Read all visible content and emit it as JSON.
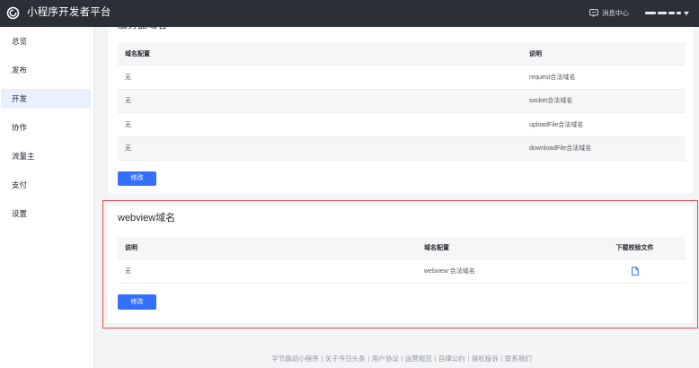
{
  "app": {
    "title": "小程序开发者平台"
  },
  "header": {
    "messages_label": "消息中心"
  },
  "icons": {
    "brand": "logo-icon",
    "messages": "message-icon",
    "user_menu": "chevron-down-icon",
    "download_verification_file": "file-icon"
  },
  "sidebar": {
    "items": [
      {
        "label": "总览"
      },
      {
        "label": "发布"
      },
      {
        "label": "开发",
        "active": true
      },
      {
        "label": "协作"
      },
      {
        "label": "流量主"
      },
      {
        "label": "支付"
      },
      {
        "label": "设置"
      }
    ]
  },
  "server_domain": {
    "title": "服务器域名",
    "columns": {
      "config": "域名配置",
      "description": "说明"
    },
    "rows": [
      {
        "config": "无",
        "description": "request合法域名"
      },
      {
        "config": "无",
        "description": "socket合法域名"
      },
      {
        "config": "无",
        "description": "uploadFile合法域名"
      },
      {
        "config": "无",
        "description": "downloadFile合法域名"
      }
    ],
    "edit_label": "修改"
  },
  "webview_domain": {
    "title": "webview域名",
    "columns": {
      "description": "说明",
      "config": "域名配置",
      "download": "下载校验文件"
    },
    "rows": [
      {
        "description": "无",
        "config": "webview 合法域名"
      }
    ],
    "edit_label": "修改"
  },
  "footer": {
    "links": [
      "字节跳动小程序",
      "关于今日头条",
      "用户协议",
      "运营规范",
      "自律公约",
      "侵权投诉",
      "联系我们"
    ]
  },
  "colors": {
    "topbar": "#2b2f36",
    "accent": "#3370ff",
    "active_nav_bg": "#e8effd",
    "highlight": "#e5484d",
    "page_bg": "#f3f4f6",
    "table_head_bg": "#f5f6f7"
  }
}
